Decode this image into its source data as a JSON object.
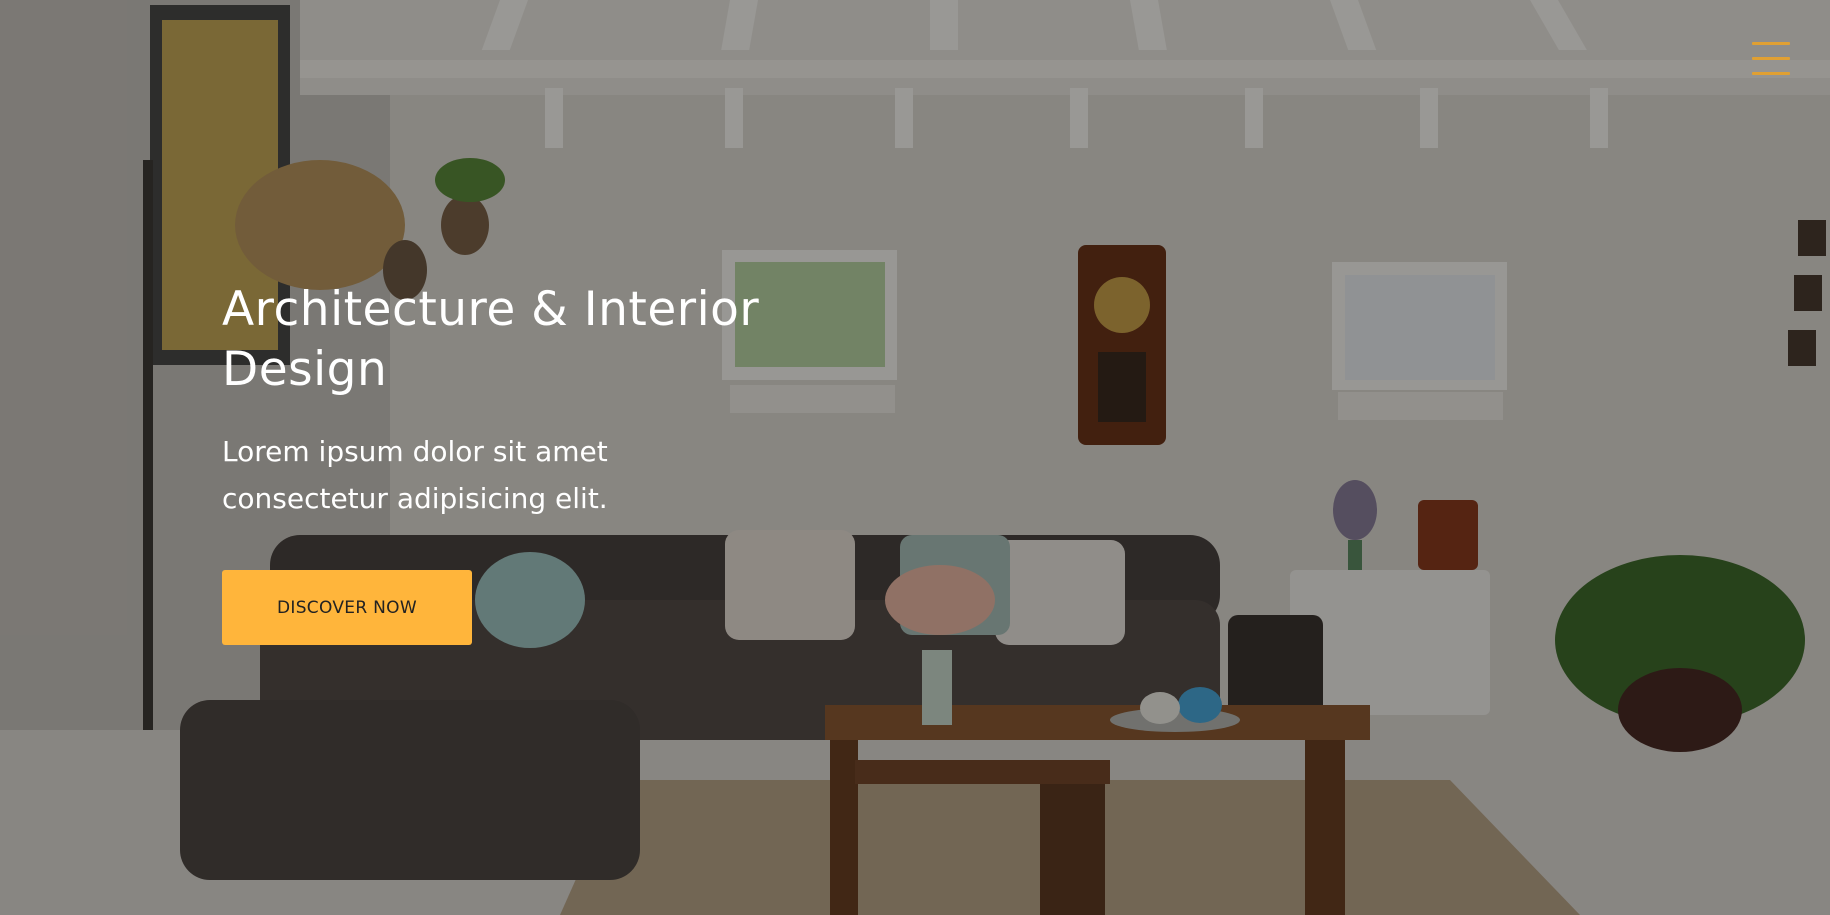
{
  "hero": {
    "title": "Architecture & Interior Design",
    "subtitle": "Lorem ipsum dolor sit amet consectetur adipisicing elit.",
    "cta_label": "DISCOVER NOW",
    "accent_color": "#ffb53b"
  },
  "nav": {
    "menu_icon": "hamburger-menu-icon"
  },
  "background": {
    "image_description_icon": "living-room-photo"
  }
}
